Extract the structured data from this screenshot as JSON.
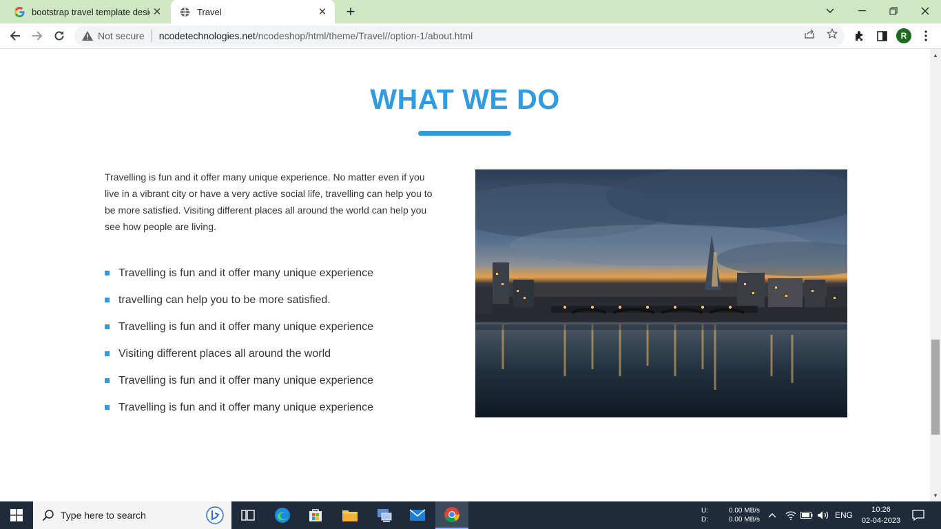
{
  "browser": {
    "tabs": [
      {
        "title": "bootstrap travel template design",
        "favicon": "google-icon",
        "active": false
      },
      {
        "title": "Travel",
        "favicon": "globe-icon",
        "active": true
      }
    ],
    "new_tab_icon": "plus-icon",
    "address": {
      "security_label": "Not secure",
      "host": "ncodetechnologies.net",
      "path": "/ncodeshop/html/theme/Travel//option-1/about.html"
    },
    "profile_initial": "R"
  },
  "page": {
    "heading": "WHAT WE DO",
    "intro": "Travelling is fun and it offer many unique experience. No matter even if you live in a vibrant city or have a very active social life, travelling can help you to be more satisfied. Visiting different places all around the world can help you see how people are living.",
    "features": [
      "Travelling is fun and it offer many unique experience",
      "travelling can help you to be more satisfied.",
      "Travelling is fun and it offer many unique experience",
      "Visiting different places all around the world",
      "Travelling is fun and it offer many unique experience",
      "Travelling is fun and it offer many unique experience"
    ],
    "accent_color": "#2f9be0"
  },
  "taskbar": {
    "search_placeholder": "Type here to search",
    "net_up_label": "U:",
    "net_down_label": "D:",
    "net_up": "0.00 MB/s",
    "net_down": "0.00 MB/s",
    "language": "ENG",
    "time": "10:26",
    "date": "02-04-2023"
  }
}
